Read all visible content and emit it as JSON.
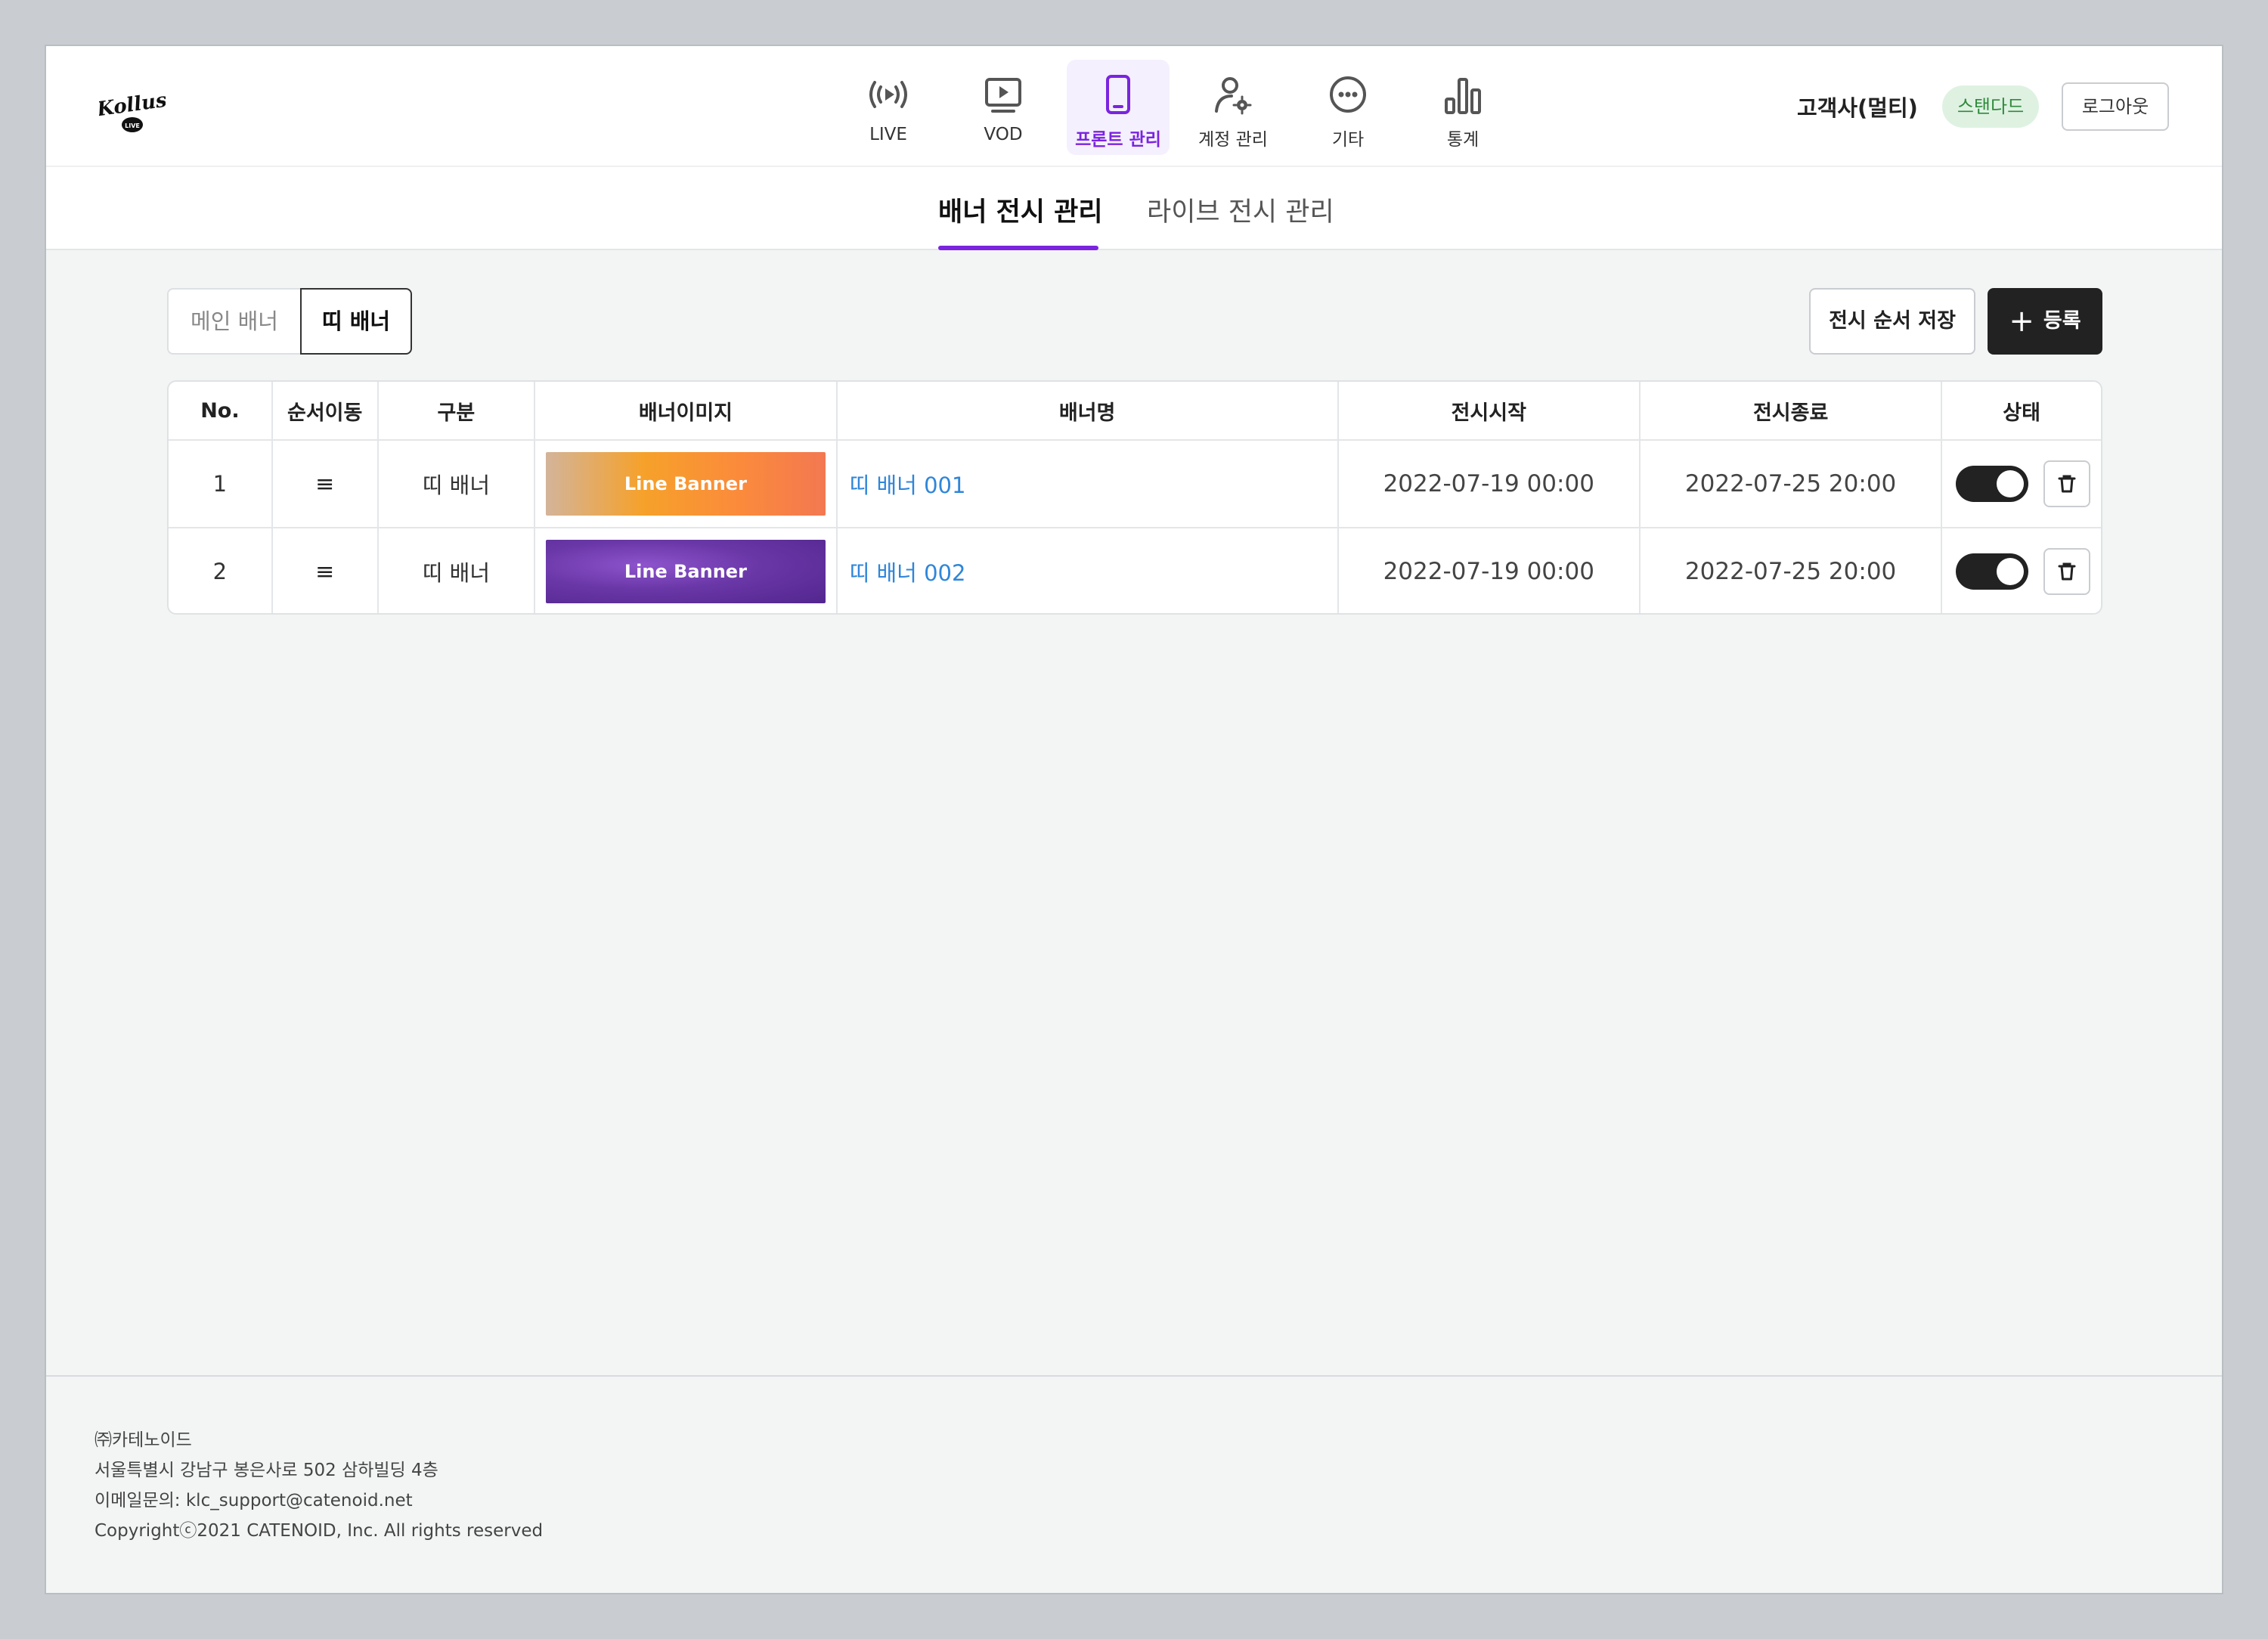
{
  "header": {
    "logo_text": "Kollus",
    "logo_sub": "LIVE",
    "nav": [
      {
        "label": "LIVE",
        "icon": "live-broadcast-icon"
      },
      {
        "label": "VOD",
        "icon": "video-play-icon"
      },
      {
        "label": "프론트 관리",
        "icon": "mobile-phone-icon",
        "active": true
      },
      {
        "label": "계정 관리",
        "icon": "user-settings-icon"
      },
      {
        "label": "기타",
        "icon": "more-dots-icon"
      },
      {
        "label": "통계",
        "icon": "bar-chart-icon"
      }
    ],
    "customer_name": "고객사(멀티)",
    "plan_badge": "스탠다드",
    "logout_label": "로그아웃"
  },
  "tabs": [
    {
      "label": "배너 전시 관리",
      "active": true
    },
    {
      "label": "라이브 전시 관리",
      "active": false
    }
  ],
  "filter": {
    "options": [
      "메인 배너",
      "띠 배너"
    ],
    "selected": "띠 배너"
  },
  "actions": {
    "save_order_label": "전시 순서 저장",
    "add_label": "등록",
    "add_icon": "+"
  },
  "table": {
    "columns": [
      "No.",
      "순서이동",
      "구분",
      "배너이미지",
      "배너명",
      "전시시작",
      "전시종료",
      "상태"
    ],
    "rows": [
      {
        "no": "1",
        "drag": "≡",
        "type": "띠 배너",
        "image_text": "Line Banner",
        "name": "띠 배너 001",
        "start": "2022-07-19 00:00",
        "end": "2022-07-25 20:00",
        "enabled": true
      },
      {
        "no": "2",
        "drag": "≡",
        "type": "띠 배너",
        "image_text": "Line Banner",
        "name": "띠 배너 002",
        "start": "2022-07-19 00:00",
        "end": "2022-07-25 20:00",
        "enabled": true
      }
    ]
  },
  "footer": {
    "lines": [
      "㈜카테노이드",
      "서울특별시 강남구 봉은사로 502 삼하빌딩 4층",
      "이메일문의: klc_support@catenoid.net",
      "Copyrightⓒ2021 CATENOID, Inc. All rights reserved"
    ]
  },
  "colors": {
    "accent": "#7a24e0",
    "link": "#2f86d9",
    "badge_bg": "#dff2e2",
    "badge_text": "#2f8a3b",
    "dark": "#222222"
  }
}
